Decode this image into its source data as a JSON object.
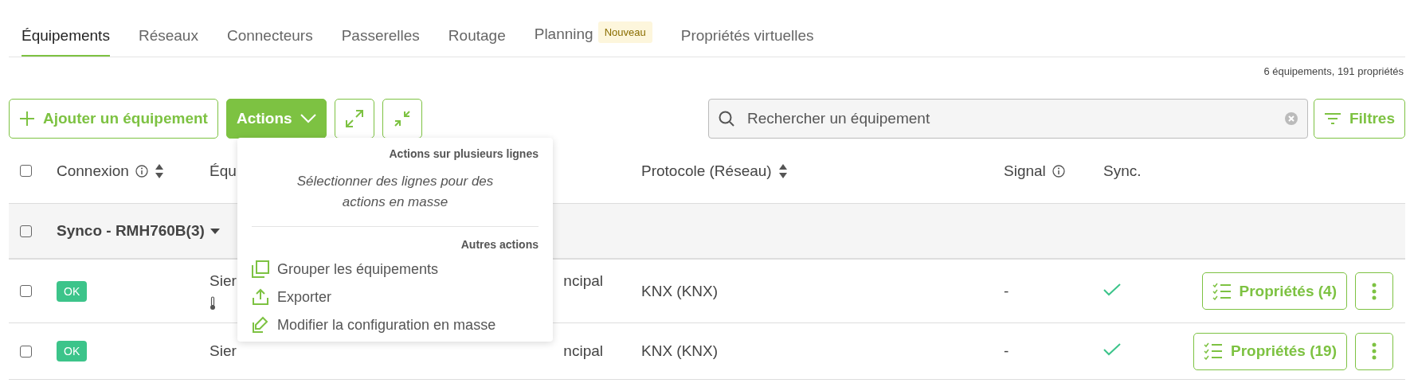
{
  "tabs": [
    {
      "label": "Équipements",
      "selected": true
    },
    {
      "label": "Réseaux",
      "selected": false
    },
    {
      "label": "Connecteurs",
      "selected": false
    },
    {
      "label": "Passerelles",
      "selected": false
    },
    {
      "label": "Routage",
      "selected": false
    },
    {
      "label": "Planning",
      "selected": false,
      "badge": "Nouveau"
    },
    {
      "label": "Propriétés virtuelles",
      "selected": false
    }
  ],
  "summary": "6 équipements, 191 propriétés",
  "toolbar": {
    "add_button": "Ajouter un équipement",
    "actions_button": {
      "label": "Actions",
      "expanded": true
    },
    "search": {
      "placeholder": "Rechercher un équipement"
    },
    "filter_button": "Filtres"
  },
  "actions_menu": {
    "heading": "Actions sur plusieurs lignes",
    "note": "Sélectionner des lignes pour des actions en masse",
    "other_heading": "Autres actions",
    "items": [
      {
        "kind": "group",
        "label": "Grouper les équipements"
      },
      {
        "kind": "export",
        "label": "Exporter"
      },
      {
        "kind": "edit",
        "label": "Modifier la configuration en masse"
      }
    ]
  },
  "table": {
    "select_all": {
      "checked": false
    },
    "columns": [
      {
        "label": "Connexion",
        "info": true,
        "sortable": true
      },
      {
        "label": "Équ",
        "info": false,
        "sortable": false
      },
      {
        "label": "Protocole (Réseau)",
        "info": false,
        "sortable": true
      },
      {
        "label": "Signal",
        "info": true,
        "sortable": false
      },
      {
        "label": "Sync.",
        "info": false,
        "sortable": false
      }
    ],
    "group": {
      "label": "Synco - RMH760B(3)",
      "checked": false,
      "expanded": true
    },
    "rows": [
      {
        "checked": false,
        "status": "OK",
        "device": "Sier",
        "thermometer": true,
        "column_3": "ncipal",
        "protocol": "KNX (KNX)",
        "signal": "-",
        "synced": true,
        "properties_button": "Propriétés (4)"
      },
      {
        "checked": false,
        "status": "OK",
        "device": "Sier",
        "thermometer": false,
        "column_3": "ncipal",
        "protocol": "KNX (KNX)",
        "signal": "-",
        "synced": true,
        "properties_button": "Propriétés (19)"
      }
    ]
  }
}
